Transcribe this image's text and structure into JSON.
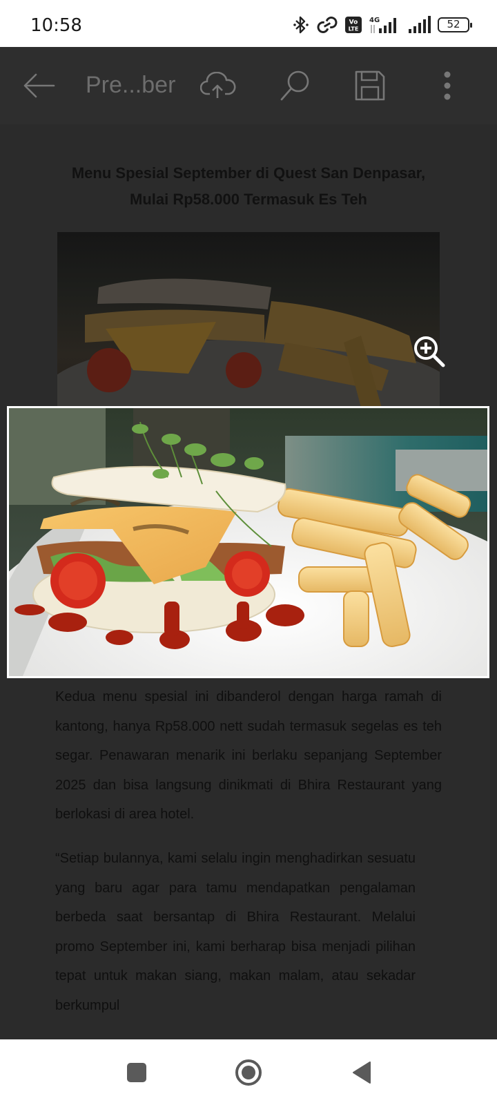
{
  "status_bar": {
    "time": "10:58",
    "battery": "52",
    "network": "4G",
    "volte": "Vo LTE",
    "icons": [
      "bluetooth-icon",
      "link-icon",
      "volte-icon",
      "signal-icon",
      "signal-icon",
      "battery-icon"
    ]
  },
  "app_bar": {
    "title": "Pre...ber",
    "icons": [
      "back-arrow-icon",
      "cloud-upload-icon",
      "search-icon",
      "save-icon",
      "more-vert-icon"
    ]
  },
  "article": {
    "title": "Menu Spesial September di Quest San Denpasar, Mulai Rp58.000 Termasuk Es Teh",
    "paragraph_1": "Kedua menu spesial ini dibanderol dengan harga ramah di kantong, hanya Rp58.000 nett sudah termasuk segelas es teh segar. Penawaran menarik ini berlaku sepanjang September 2025 dan bisa langsung dinikmati di Bhira Restaurant yang berlokasi di area hotel.",
    "paragraph_2": "“Setiap bulannya, kami selalu ingin menghadirkan sesuatu yang baru agar para tamu mendapatkan pengalaman berbeda saat bersantap di Bhira Restaurant. Melalui promo September ini, kami berharap bisa menjadi pilihan tepat untuk makan siang, makan malam, atau sekadar berkumpul"
  },
  "image": {
    "zoom_icon": "zoom-in-icon",
    "subject": "food-photo"
  },
  "nav_bar": {
    "icons": [
      "recents-square-icon",
      "home-circle-icon",
      "back-triangle-icon"
    ]
  },
  "colors": {
    "overlay": "#2b2b2b",
    "status_bg": "#ffffff",
    "nav_bg": "#ffffff",
    "text_dim": "#111111"
  }
}
